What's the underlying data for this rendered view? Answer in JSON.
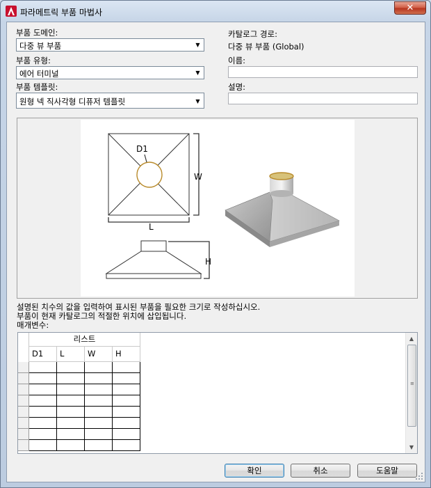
{
  "window": {
    "title": "파라메트릭 부품 마법사",
    "close_symbol": "✕"
  },
  "left_form": {
    "domain_label": "부품 도메인:",
    "domain_value": "다중 뷰 부품",
    "type_label": "부품 유형:",
    "type_value": "에어 터미널",
    "template_label": "부품 템플릿:",
    "template_value": "원형 넥 직사각형 디퓨저 템플릿"
  },
  "right_form": {
    "catalog_path_label": "카탈로그 경로:",
    "catalog_path_value": "다중 뷰 부품 (Global)",
    "name_label": "이름:",
    "name_value": "",
    "description_label": "설명:",
    "description_value": ""
  },
  "preview": {
    "d1_label": "D1",
    "w_label": "W",
    "l_label": "L",
    "h_label": "H"
  },
  "instructions": {
    "line1": "설명된 치수의 값을 입력하여 표시된 부품을 필요한 크기로 작성하십시오.",
    "line2": "부품이 현재 카탈로그의 적절한 위치에 삽입됩니다.",
    "params_label": "매개변수:"
  },
  "grid": {
    "group_header": "리스트",
    "columns": [
      "D1",
      "L",
      "W",
      "H"
    ],
    "row_count": 8
  },
  "buttons": {
    "ok": "확인",
    "cancel": "취소",
    "help": "도움말"
  },
  "colors": {
    "accent_circle": "#b88a2a",
    "close_red": "#c8462e"
  },
  "icons": {
    "app": "autocad-icon",
    "combo_arrow": "▼",
    "scroll_up": "▲",
    "scroll_down": "▼"
  }
}
